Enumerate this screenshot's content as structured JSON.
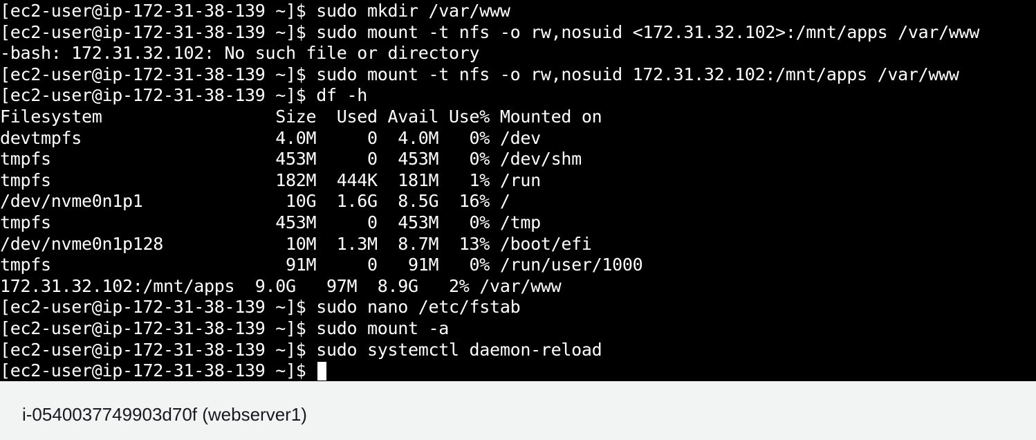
{
  "terminal": {
    "lines": [
      "[ec2-user@ip-172-31-38-139 ~]$ sudo mkdir /var/www",
      "[ec2-user@ip-172-31-38-139 ~]$ sudo mount -t nfs -o rw,nosuid <172.31.32.102>:/mnt/apps /var/www",
      "-bash: 172.31.32.102: No such file or directory",
      "[ec2-user@ip-172-31-38-139 ~]$ sudo mount -t nfs -o rw,nosuid 172.31.32.102:/mnt/apps /var/www",
      "[ec2-user@ip-172-31-38-139 ~]$ df -h",
      "Filesystem                 Size  Used Avail Use% Mounted on",
      "devtmpfs                   4.0M     0  4.0M   0% /dev",
      "tmpfs                      453M     0  453M   0% /dev/shm",
      "tmpfs                      182M  444K  181M   1% /run",
      "/dev/nvme0n1p1              10G  1.6G  8.5G  16% /",
      "tmpfs                      453M     0  453M   0% /tmp",
      "/dev/nvme0n1p128            10M  1.3M  8.7M  13% /boot/efi",
      "tmpfs                       91M     0   91M   0% /run/user/1000",
      "172.31.32.102:/mnt/apps  9.0G   97M  8.9G   2% /var/www",
      "[ec2-user@ip-172-31-38-139 ~]$ sudo nano /etc/fstab",
      "[ec2-user@ip-172-31-38-139 ~]$ sudo mount -a",
      "[ec2-user@ip-172-31-38-139 ~]$ sudo systemctl daemon-reload"
    ],
    "prompt": "[ec2-user@ip-172-31-38-139 ~]$",
    "background_color": "#000000",
    "text_color": "#ffffff"
  },
  "status_bar": {
    "instance_label": "i-0540037749903d70f (webserver1)",
    "background_color": "#f2f3f3"
  }
}
